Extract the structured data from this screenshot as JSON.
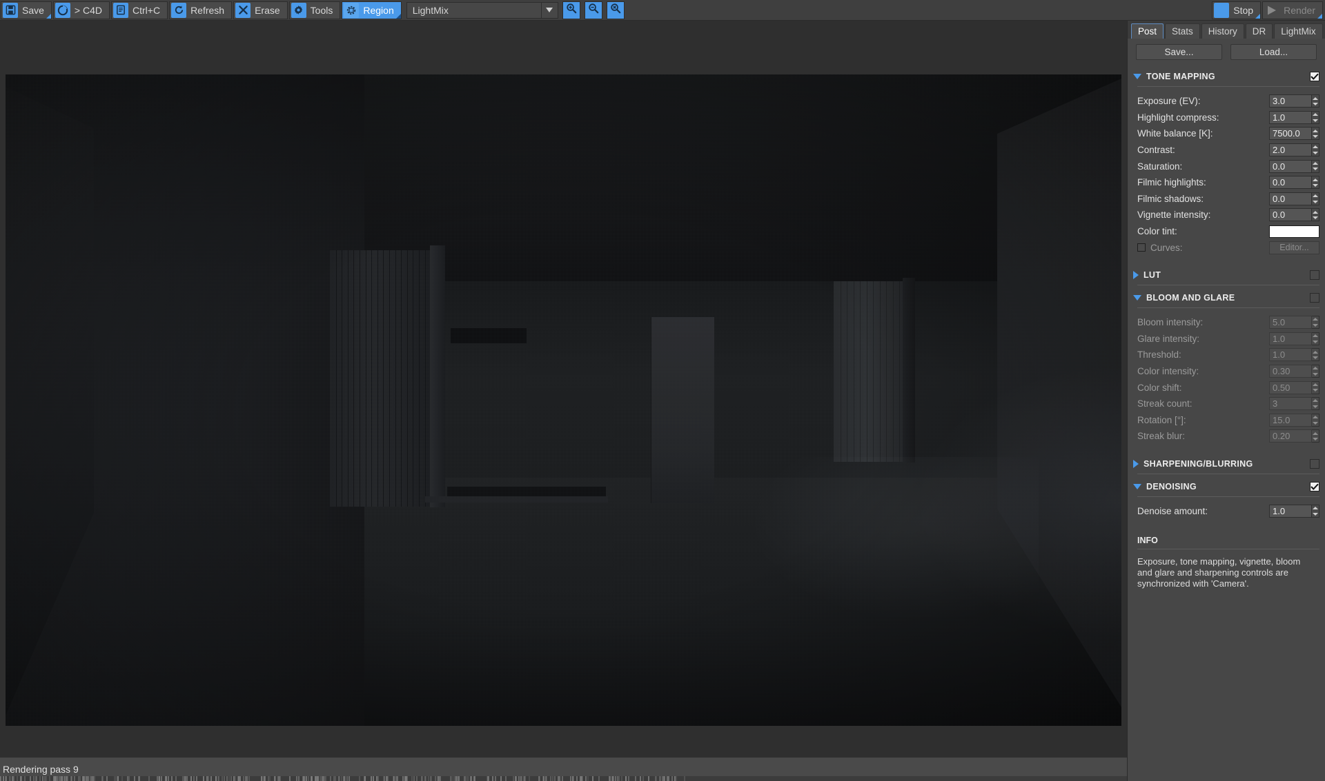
{
  "toolbar": {
    "buttons": [
      {
        "label": "Save",
        "icon": "floppy-disk-icon",
        "active": false,
        "corner": true
      },
      {
        "label": "> C4D",
        "icon": "c4d-logo-icon",
        "active": false,
        "corner": false
      },
      {
        "label": "Ctrl+C",
        "icon": "clipboard-icon",
        "active": false,
        "corner": false
      },
      {
        "label": "Refresh",
        "icon": "refresh-icon",
        "active": false,
        "corner": false
      },
      {
        "label": "Erase",
        "icon": "erase-x-icon",
        "active": false,
        "corner": false
      },
      {
        "label": "Tools",
        "icon": "gear-icon",
        "active": false,
        "corner": false
      },
      {
        "label": "Region",
        "icon": "region-select-icon",
        "active": true,
        "corner": true
      }
    ],
    "combo_value": "LightMix",
    "combo_dropdown_icon": "chevron-down-icon",
    "zoom_buttons": [
      {
        "icon": "zoom-in-icon"
      },
      {
        "icon": "zoom-out-icon"
      },
      {
        "icon": "zoom-reset-icon"
      }
    ],
    "stop_label": "Stop",
    "stop_icon": "stop-square-icon",
    "render_label": "Render",
    "render_icon": "play-triangle-icon"
  },
  "status": {
    "text": "Rendering pass 9"
  },
  "panel": {
    "tabs": [
      {
        "label": "Post",
        "selected": true
      },
      {
        "label": "Stats",
        "selected": false
      },
      {
        "label": "History",
        "selected": false
      },
      {
        "label": "DR",
        "selected": false
      },
      {
        "label": "LightMix",
        "selected": false
      }
    ],
    "save_label": "Save...",
    "load_label": "Load...",
    "sections": [
      {
        "name": "tone_mapping",
        "title": "TONE MAPPING",
        "expanded": true,
        "enabled": true,
        "rows": [
          {
            "label": "Exposure (EV):",
            "value": "3.0",
            "kind": "number",
            "dim": false
          },
          {
            "label": "Highlight compress:",
            "value": "1.0",
            "kind": "number",
            "dim": false
          },
          {
            "label": "White balance [K]:",
            "value": "7500.0",
            "kind": "number",
            "dim": false
          },
          {
            "label": "Contrast:",
            "value": "2.0",
            "kind": "number",
            "dim": false
          },
          {
            "label": "Saturation:",
            "value": "0.0",
            "kind": "number",
            "dim": false
          },
          {
            "label": "Filmic highlights:",
            "value": "0.0",
            "kind": "number",
            "dim": false
          },
          {
            "label": "Filmic shadows:",
            "value": "0.0",
            "kind": "number",
            "dim": false
          },
          {
            "label": "Vignette intensity:",
            "value": "0.0",
            "kind": "number",
            "dim": false
          },
          {
            "label": "Color tint:",
            "value": "#FFFFFF",
            "kind": "color",
            "dim": false
          },
          {
            "label": "Curves:",
            "value": "Editor...",
            "kind": "checkbox-button",
            "checked": false,
            "dim": true
          }
        ]
      },
      {
        "name": "lut",
        "title": "LUT",
        "expanded": false,
        "enabled": false,
        "rows": []
      },
      {
        "name": "bloom_and_glare",
        "title": "BLOOM AND GLARE",
        "expanded": true,
        "enabled": false,
        "rows": [
          {
            "label": "Bloom intensity:",
            "value": "5.0",
            "kind": "number",
            "dim": true
          },
          {
            "label": "Glare intensity:",
            "value": "1.0",
            "kind": "number",
            "dim": true
          },
          {
            "label": "Threshold:",
            "value": "1.0",
            "kind": "number",
            "dim": true
          },
          {
            "label": "Color intensity:",
            "value": "0.30",
            "kind": "number",
            "dim": true
          },
          {
            "label": "Color shift:",
            "value": "0.50",
            "kind": "number",
            "dim": true
          },
          {
            "label": "Streak count:",
            "value": "3",
            "kind": "number",
            "dim": true
          },
          {
            "label": "Rotation [°]:",
            "value": "15.0",
            "kind": "number",
            "dim": true
          },
          {
            "label": "Streak blur:",
            "value": "0.20",
            "kind": "number",
            "dim": true
          }
        ]
      },
      {
        "name": "sharpening_blurring",
        "title": "SHARPENING/BLURRING",
        "expanded": false,
        "enabled": false,
        "rows": []
      },
      {
        "name": "denoising",
        "title": "DENOISING",
        "expanded": true,
        "enabled": true,
        "rows": [
          {
            "label": "Denoise amount:",
            "value": "1.0",
            "kind": "number",
            "dim": false
          }
        ]
      }
    ],
    "info_title": "INFO",
    "info_body": "Exposure, tone mapping, vignette, bloom and glare and sharpening controls are synchronized with 'Camera'."
  },
  "colors": {
    "accent": "#4a9aea",
    "panel_bg": "#474747",
    "toolbar_bg": "#3f3f3f",
    "viewport_bg": "#2f2f2f",
    "text": "#e2e2e2",
    "text_dim": "#8d8d8d",
    "tint_swatch": "#ffffff"
  },
  "render": {
    "description": "Dark interior room render — noisy progressive path-trace preview"
  }
}
